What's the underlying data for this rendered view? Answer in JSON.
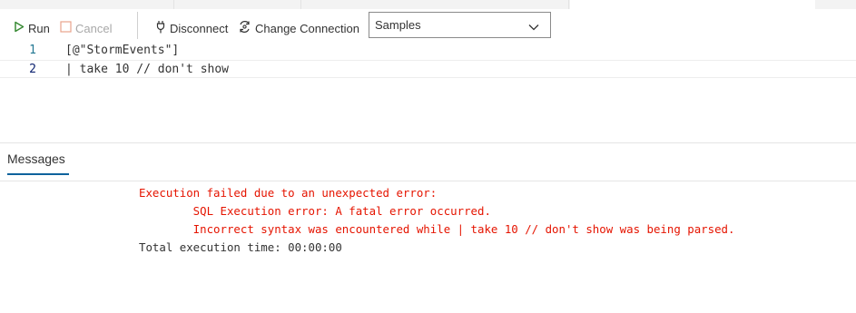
{
  "toolbar": {
    "run_label": "Run",
    "cancel_label": "Cancel",
    "disconnect_label": "Disconnect",
    "change_connection_label": "Change Connection",
    "database_select": {
      "selected": "Samples"
    }
  },
  "editor": {
    "lines": [
      {
        "number": "1",
        "text": "[@\"StormEvents\"]"
      },
      {
        "number": "2",
        "text": "| take 10 // don't show"
      }
    ]
  },
  "messages_panel": {
    "tab_label": "Messages",
    "lines": [
      "Execution failed due to an unexpected error:",
      "        SQL Execution error: A fatal error occurred.",
      "        Incorrect syntax was encountered while | take 10 // don't show was being parsed.",
      "Total execution time: 00:00:00"
    ]
  },
  "colors": {
    "error_text": "#e51400",
    "run_icon": "#388a34",
    "line_number": "#237893",
    "tab_underline": "#0e639c"
  },
  "icons": {
    "run": "run-icon",
    "cancel": "cancel-icon",
    "disconnect": "disconnect-icon",
    "change_connection": "change-connection-icon",
    "dropdown": "chevron-down-icon"
  }
}
